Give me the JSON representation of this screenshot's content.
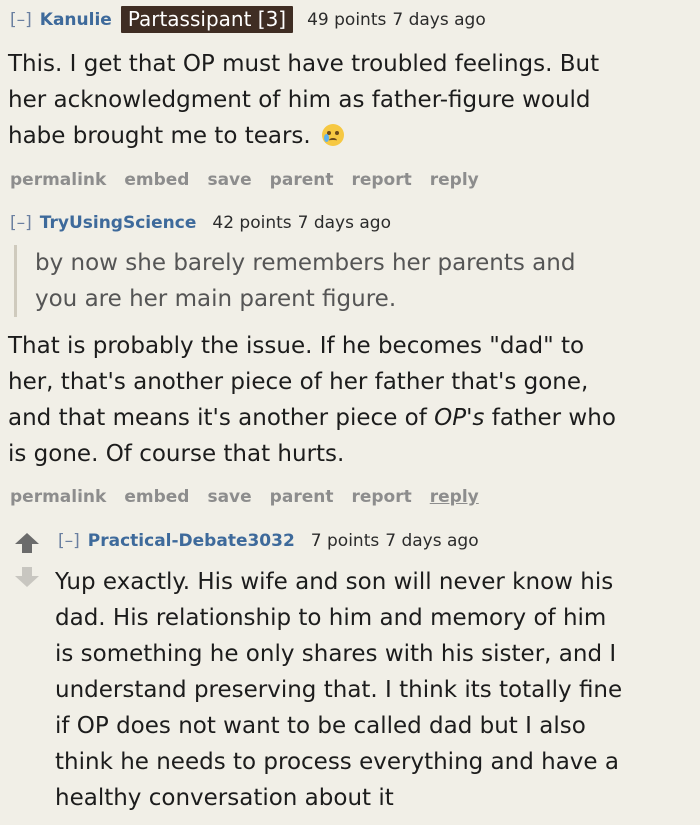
{
  "comments": [
    {
      "collapse": "[–]",
      "author": "Kanulie",
      "flair": "Partassipant [3]",
      "score": "49 points",
      "time": "7 days ago",
      "lines": [
        "This. I get that OP must have troubled feelings. But",
        "her acknowledgment of him as father-figure would",
        "habe brought me to tears."
      ],
      "emoji": "crying-face-icon",
      "actions": [
        "permalink",
        "embed",
        "save",
        "parent",
        "report",
        "reply"
      ]
    },
    {
      "collapse": "[–]",
      "author": "TryUsingScience",
      "score": "42 points",
      "time": "7 days ago",
      "quote": [
        "by now she barely remembers her parents and",
        "you are her main parent figure."
      ],
      "lines": [
        "That is probably the issue. If he becomes \"dad\" to",
        "her, that's another piece of her father that's gone,",
        "and that means it's another piece of ",
        "OP's",
        " father who",
        "is gone. Of course that hurts."
      ],
      "actions": [
        "permalink",
        "embed",
        "save",
        "parent",
        "report",
        "reply"
      ]
    },
    {
      "collapse": "[–]",
      "author": "Practical-Debate3032",
      "score": "7 points",
      "time": "7 days ago",
      "lines": [
        "Yup exactly. His wife and son will never know his",
        "dad. His relationship to him and memory of him",
        "is something he only shares with his sister, and I",
        "understand preserving that. I think its totally fine",
        "if OP does not want to be called dad but I also",
        "think he needs to process everything and have a",
        "healthy conversation about it"
      ]
    }
  ],
  "colors": {
    "background": "#f1efe7",
    "author": "#3e6a9b",
    "flair_bg": "#3f2d23",
    "actions": "#8d8d8d"
  }
}
